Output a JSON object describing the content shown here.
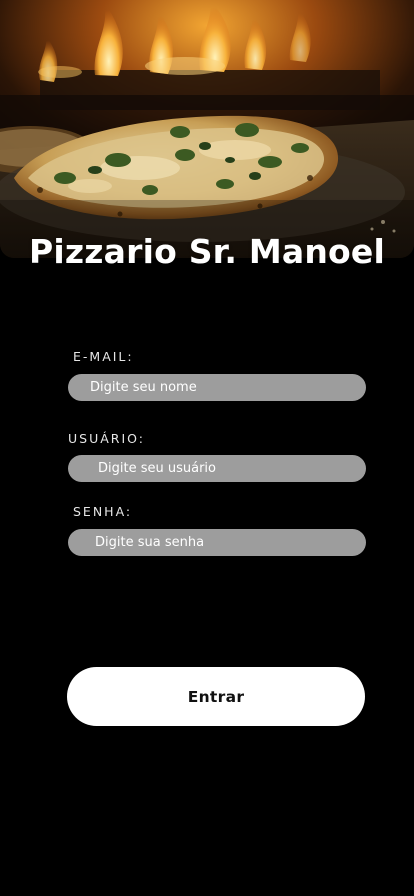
{
  "app": {
    "title": "Pizzario Sr. Manoel"
  },
  "hero": {
    "image": "pizza-in-wood-fired-oven"
  },
  "form": {
    "email": {
      "label": "E-MAIL:",
      "placeholder": "Digite seu nome",
      "value": ""
    },
    "user": {
      "label": "USUÁRIO:",
      "placeholder": "Digite seu usuário",
      "value": ""
    },
    "password": {
      "label": "SENHA:",
      "placeholder": "Digite sua senha",
      "value": ""
    },
    "submit_label": "Entrar"
  },
  "colors": {
    "background": "#000000",
    "input_fill": "#9d9d9d",
    "button_fill": "#ffffff",
    "button_text": "#111111",
    "title": "#ffffff"
  }
}
